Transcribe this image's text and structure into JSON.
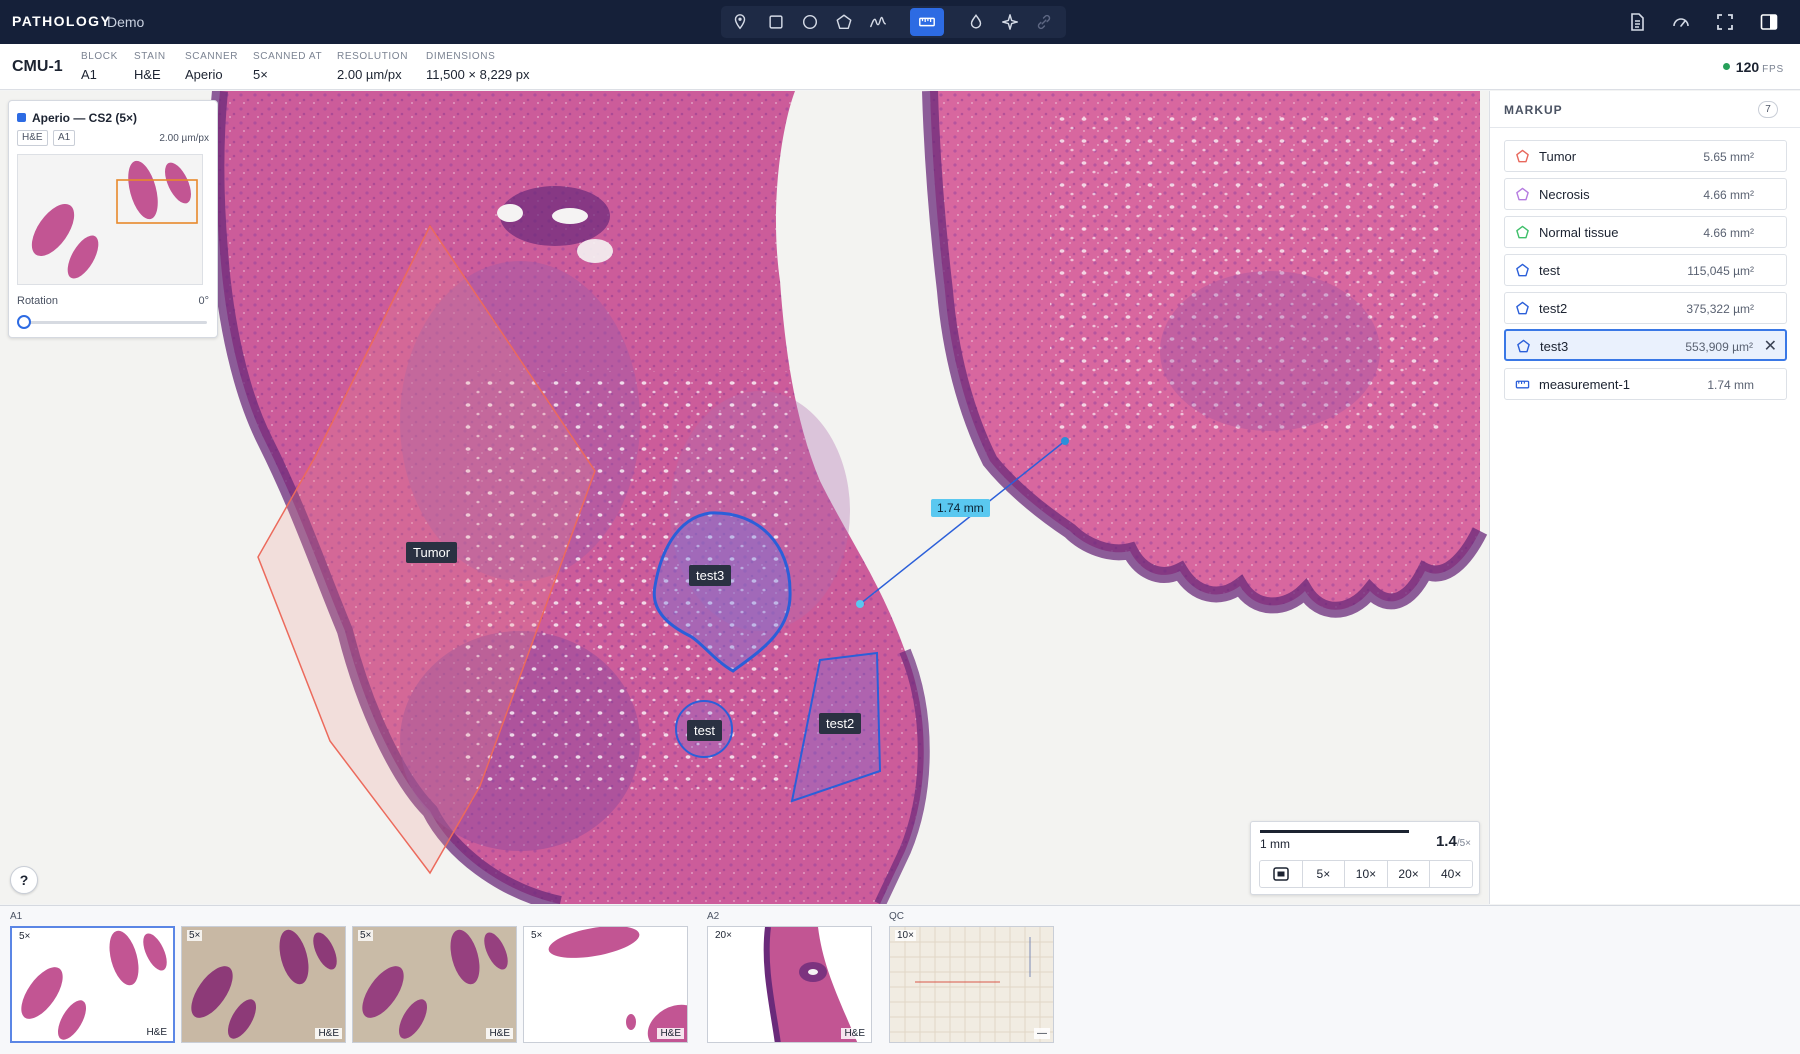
{
  "app": {
    "brand": "PATHOLOGY",
    "mode": "Demo"
  },
  "toolbar": {
    "tools": [
      {
        "name": "pin-tool",
        "icon": "pin-icon"
      },
      {
        "name": "rectangle-tool",
        "icon": "rectangle-icon"
      },
      {
        "name": "circle-tool",
        "icon": "circle-icon"
      },
      {
        "name": "polygon-tool",
        "icon": "polygon-icon"
      },
      {
        "name": "freehand-tool",
        "icon": "freehand-icon"
      },
      {
        "name": "ruler-tool",
        "icon": "ruler-icon",
        "active": true
      },
      {
        "name": "stain-tool",
        "icon": "droplet-icon"
      },
      {
        "name": "ai-tool",
        "icon": "sparkle-icon"
      },
      {
        "name": "link-tool",
        "icon": "link-icon",
        "disabled": true
      }
    ],
    "right": [
      "document-icon",
      "gauge-icon",
      "fullscreen-icon",
      "sidebar-toggle-icon"
    ]
  },
  "slide": {
    "id": "CMU-1",
    "meta": [
      {
        "key": "BLOCK",
        "value": "A1"
      },
      {
        "key": "STAIN",
        "value": "H&E"
      },
      {
        "key": "SCANNER",
        "value": "Aperio"
      },
      {
        "key": "SCANNED AT",
        "value": "5×"
      },
      {
        "key": "RESOLUTION",
        "value": "2.00 µm/px"
      },
      {
        "key": "DIMENSIONS",
        "value": "11,500 × 8,229 px"
      }
    ],
    "fps": "120",
    "fps_unit": "FPS"
  },
  "overview": {
    "title": "Aperio — CS2 (5×)",
    "chips": [
      "H&E",
      "A1"
    ],
    "resolution": "2.00 µm/px",
    "rotation_label": "Rotation",
    "rotation_value": "0°",
    "rotation_fraction": 0
  },
  "annotations": {
    "tumor": "Tumor",
    "test": "test",
    "test2": "test2",
    "test3": "test3",
    "measurement": "1.74 mm"
  },
  "help": "?",
  "zoom": {
    "scale_label": "1 mm",
    "current": "1.4",
    "suffix": "/5×",
    "buttons": [
      "5×",
      "10×",
      "20×",
      "40×"
    ]
  },
  "markup": {
    "title": "MARKUP",
    "count": "7",
    "items": [
      {
        "name": "Tumor",
        "area": "5.65 mm²",
        "color": "#e8685c",
        "shape": "pentagon"
      },
      {
        "name": "Necrosis",
        "area": "4.66 mm²",
        "color": "#b57be0",
        "shape": "pentagon"
      },
      {
        "name": "Normal tissue",
        "area": "4.66 mm²",
        "color": "#3fbf6a",
        "shape": "pentagon"
      },
      {
        "name": "test",
        "area": "115,045 µm²",
        "color": "#2b5fd9",
        "shape": "pentagon"
      },
      {
        "name": "test2",
        "area": "375,322 µm²",
        "color": "#2b5fd9",
        "shape": "pentagon"
      },
      {
        "name": "test3",
        "area": "553,909 µm²",
        "color": "#2b5fd9",
        "shape": "pentagon",
        "selected": true
      },
      {
        "name": "measurement-1",
        "area": "1.74 mm",
        "color": "#2b5fd9",
        "shape": "ruler"
      }
    ],
    "close": "✕"
  },
  "filmstrip": {
    "groups": [
      "A1",
      "A2",
      "QC"
    ],
    "thumbs": [
      {
        "zoom": "5×",
        "stain": "H&E",
        "selected": true
      },
      {
        "zoom": "5×",
        "stain": "H&E"
      },
      {
        "zoom": "5×",
        "stain": "H&E"
      },
      {
        "zoom": "5×",
        "stain": "H&E"
      },
      {
        "zoom": "20×",
        "stain": "H&E"
      },
      {
        "zoom": "10×",
        "stain": "—"
      }
    ]
  },
  "colors": {
    "topbar": "#152039",
    "accent": "#2d6be3",
    "tumor": "#e8685c",
    "annotation_blue": "#2b5fd9",
    "measure": "#5ac8f0"
  }
}
